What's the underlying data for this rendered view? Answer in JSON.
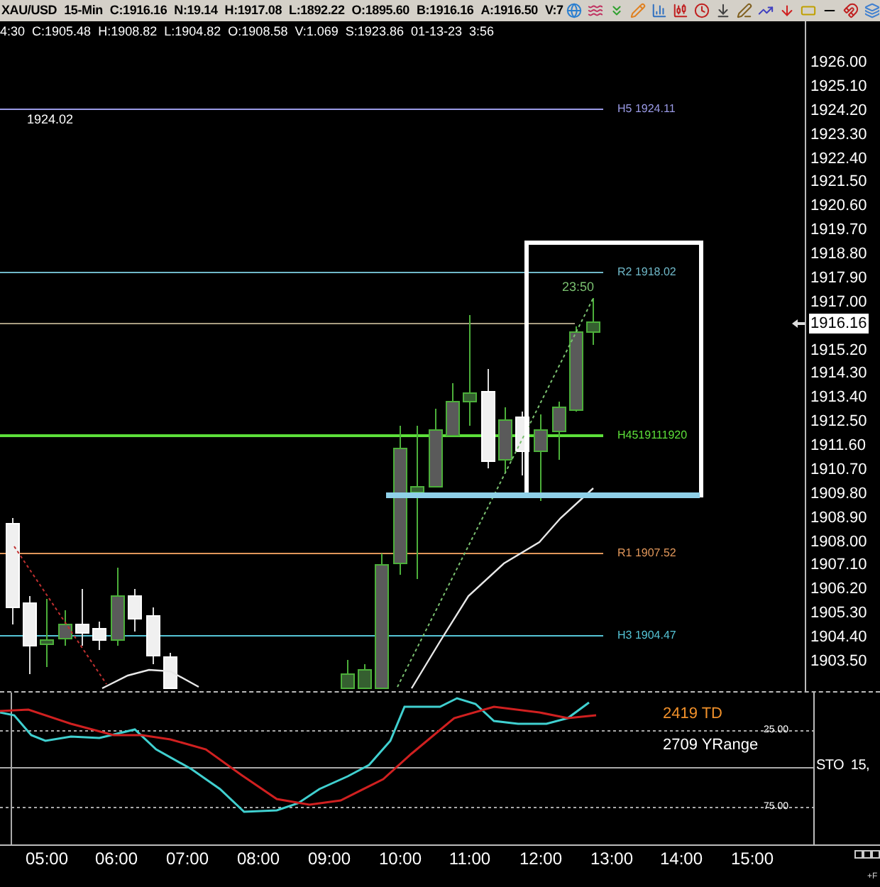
{
  "title_bar": {
    "symbol": "XAU/USD",
    "interval": "15-Min",
    "quote_fields": [
      "C:1916.16",
      "N:19.14",
      "H:1917.08",
      "L:1892.22",
      "O:1895.60",
      "B:1916.16",
      "A:1916.50",
      "V:7"
    ]
  },
  "info_line": [
    "4:30",
    "C:1905.48",
    "H:1908.82",
    "L:1904.82",
    "O:1908.58",
    "V:1.069",
    "S:1923.86",
    "01-13-23",
    "3:56"
  ],
  "price_chart": {
    "price_axis_labels": [
      "1926.00",
      "1925.10",
      "1924.20",
      "1923.30",
      "1922.40",
      "1921.50",
      "1920.60",
      "1919.70",
      "1918.80",
      "1917.90",
      "1917.00",
      "1915.20",
      "1914.30",
      "1913.40",
      "1912.50",
      "1911.60",
      "1910.70",
      "1909.80",
      "1908.90",
      "1908.00",
      "1907.10",
      "1906.20",
      "1905.30",
      "1904.40",
      "1903.50"
    ],
    "current_price": "1916.16",
    "level_lines": [
      {
        "label": "H5 1924.11",
        "color": "#9a9ae6"
      },
      {
        "label": "R2 1918.02",
        "color": "#6fb8c8"
      },
      {
        "label": "H4519111920",
        "color": "#5de03a"
      },
      {
        "label": "R1 1907.52",
        "color": "#e0965a"
      },
      {
        "label": "H3 1904.47",
        "color": "#55c4d6"
      }
    ],
    "high_note": "1924.02",
    "timer": "23:50"
  },
  "oscillator": {
    "labels": [
      {
        "text": "2419 TD",
        "color": "#f0902a"
      },
      {
        "text": "2709 YRange",
        "color": "#ffffff"
      }
    ],
    "ticks": [
      "25.00",
      "75.00"
    ],
    "study_label": "STO  15,"
  },
  "time_axis": [
    "05:00",
    "06:00",
    "07:00",
    "08:00",
    "09:00",
    "10:00",
    "11:00",
    "12:00",
    "13:00",
    "14:00",
    "15:00"
  ],
  "corner_text": "+F"
}
